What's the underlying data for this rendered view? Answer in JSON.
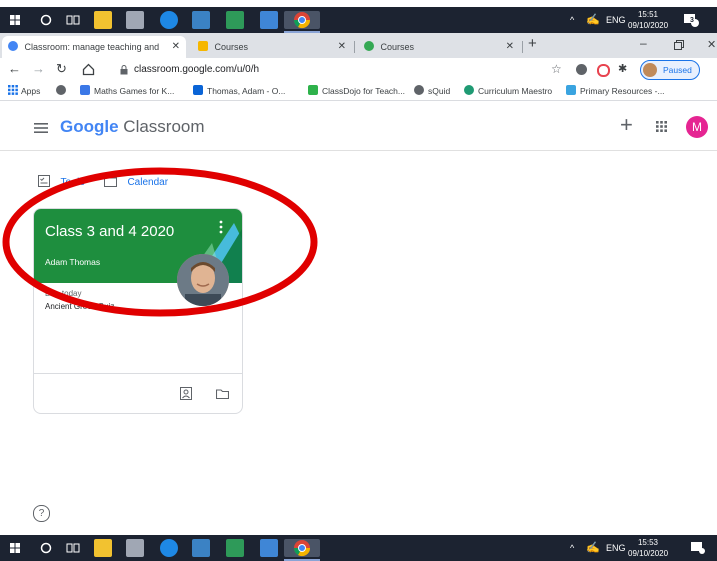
{
  "taskbar_top": {
    "tray_language": "ENG",
    "time": "15:51",
    "date": "09/10/2020",
    "notification_count": "3"
  },
  "taskbar_bottom": {
    "tray_language": "ENG",
    "time": "15:53",
    "date": "09/10/2020"
  },
  "browser": {
    "tabs": [
      {
        "label": "Classroom: manage teaching and"
      },
      {
        "label": "Courses"
      },
      {
        "label": "Courses"
      }
    ],
    "new_tab": "+",
    "url": "classroom.google.com/u/0/h",
    "profile_status": "Paused",
    "bookmarks": [
      {
        "label": "Apps"
      },
      {
        "label": "Maths Games for K..."
      },
      {
        "label": "Thomas, Adam - O..."
      },
      {
        "label": "ClassDojo for Teach..."
      },
      {
        "label": "sQuid"
      },
      {
        "label": "Curriculum Maestro"
      },
      {
        "label": "Primary Resources -..."
      }
    ]
  },
  "classroom": {
    "logo_google": "Google",
    "logo_product": "Classroom",
    "avatar_letter": "M",
    "nav": {
      "todo": "To do",
      "calendar": "Calendar"
    },
    "course": {
      "title": "Class 3 and 4 2020",
      "teacher": "Adam Thomas",
      "due_label": "Due today",
      "due_item": "Ancient Greek Quiz"
    }
  },
  "colors": {
    "banner": "#1e8e3e",
    "annotation_ring": "#e00000",
    "avatar": "#e52592",
    "link": "#1a73e8"
  }
}
